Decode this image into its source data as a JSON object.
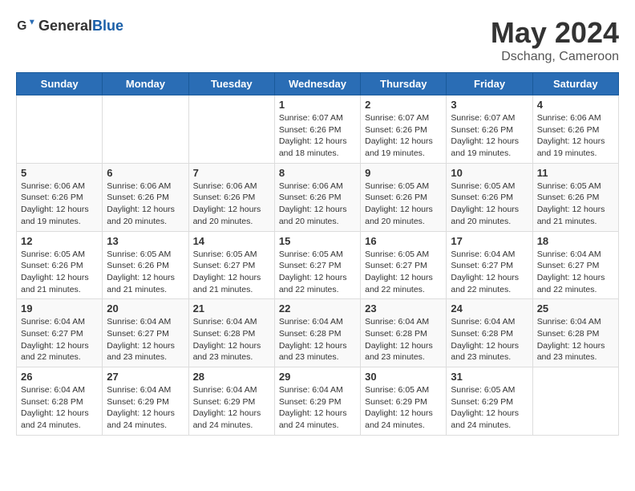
{
  "header": {
    "logo_general": "General",
    "logo_blue": "Blue",
    "month": "May 2024",
    "location": "Dschang, Cameroon"
  },
  "days_of_week": [
    "Sunday",
    "Monday",
    "Tuesday",
    "Wednesday",
    "Thursday",
    "Friday",
    "Saturday"
  ],
  "weeks": [
    [
      {
        "day": "",
        "info": ""
      },
      {
        "day": "",
        "info": ""
      },
      {
        "day": "",
        "info": ""
      },
      {
        "day": "1",
        "info": "Sunrise: 6:07 AM\nSunset: 6:26 PM\nDaylight: 12 hours\nand 18 minutes."
      },
      {
        "day": "2",
        "info": "Sunrise: 6:07 AM\nSunset: 6:26 PM\nDaylight: 12 hours\nand 19 minutes."
      },
      {
        "day": "3",
        "info": "Sunrise: 6:07 AM\nSunset: 6:26 PM\nDaylight: 12 hours\nand 19 minutes."
      },
      {
        "day": "4",
        "info": "Sunrise: 6:06 AM\nSunset: 6:26 PM\nDaylight: 12 hours\nand 19 minutes."
      }
    ],
    [
      {
        "day": "5",
        "info": "Sunrise: 6:06 AM\nSunset: 6:26 PM\nDaylight: 12 hours\nand 19 minutes."
      },
      {
        "day": "6",
        "info": "Sunrise: 6:06 AM\nSunset: 6:26 PM\nDaylight: 12 hours\nand 20 minutes."
      },
      {
        "day": "7",
        "info": "Sunrise: 6:06 AM\nSunset: 6:26 PM\nDaylight: 12 hours\nand 20 minutes."
      },
      {
        "day": "8",
        "info": "Sunrise: 6:06 AM\nSunset: 6:26 PM\nDaylight: 12 hours\nand 20 minutes."
      },
      {
        "day": "9",
        "info": "Sunrise: 6:05 AM\nSunset: 6:26 PM\nDaylight: 12 hours\nand 20 minutes."
      },
      {
        "day": "10",
        "info": "Sunrise: 6:05 AM\nSunset: 6:26 PM\nDaylight: 12 hours\nand 20 minutes."
      },
      {
        "day": "11",
        "info": "Sunrise: 6:05 AM\nSunset: 6:26 PM\nDaylight: 12 hours\nand 21 minutes."
      }
    ],
    [
      {
        "day": "12",
        "info": "Sunrise: 6:05 AM\nSunset: 6:26 PM\nDaylight: 12 hours\nand 21 minutes."
      },
      {
        "day": "13",
        "info": "Sunrise: 6:05 AM\nSunset: 6:26 PM\nDaylight: 12 hours\nand 21 minutes."
      },
      {
        "day": "14",
        "info": "Sunrise: 6:05 AM\nSunset: 6:27 PM\nDaylight: 12 hours\nand 21 minutes."
      },
      {
        "day": "15",
        "info": "Sunrise: 6:05 AM\nSunset: 6:27 PM\nDaylight: 12 hours\nand 22 minutes."
      },
      {
        "day": "16",
        "info": "Sunrise: 6:05 AM\nSunset: 6:27 PM\nDaylight: 12 hours\nand 22 minutes."
      },
      {
        "day": "17",
        "info": "Sunrise: 6:04 AM\nSunset: 6:27 PM\nDaylight: 12 hours\nand 22 minutes."
      },
      {
        "day": "18",
        "info": "Sunrise: 6:04 AM\nSunset: 6:27 PM\nDaylight: 12 hours\nand 22 minutes."
      }
    ],
    [
      {
        "day": "19",
        "info": "Sunrise: 6:04 AM\nSunset: 6:27 PM\nDaylight: 12 hours\nand 22 minutes."
      },
      {
        "day": "20",
        "info": "Sunrise: 6:04 AM\nSunset: 6:27 PM\nDaylight: 12 hours\nand 23 minutes."
      },
      {
        "day": "21",
        "info": "Sunrise: 6:04 AM\nSunset: 6:28 PM\nDaylight: 12 hours\nand 23 minutes."
      },
      {
        "day": "22",
        "info": "Sunrise: 6:04 AM\nSunset: 6:28 PM\nDaylight: 12 hours\nand 23 minutes."
      },
      {
        "day": "23",
        "info": "Sunrise: 6:04 AM\nSunset: 6:28 PM\nDaylight: 12 hours\nand 23 minutes."
      },
      {
        "day": "24",
        "info": "Sunrise: 6:04 AM\nSunset: 6:28 PM\nDaylight: 12 hours\nand 23 minutes."
      },
      {
        "day": "25",
        "info": "Sunrise: 6:04 AM\nSunset: 6:28 PM\nDaylight: 12 hours\nand 23 minutes."
      }
    ],
    [
      {
        "day": "26",
        "info": "Sunrise: 6:04 AM\nSunset: 6:28 PM\nDaylight: 12 hours\nand 24 minutes."
      },
      {
        "day": "27",
        "info": "Sunrise: 6:04 AM\nSunset: 6:29 PM\nDaylight: 12 hours\nand 24 minutes."
      },
      {
        "day": "28",
        "info": "Sunrise: 6:04 AM\nSunset: 6:29 PM\nDaylight: 12 hours\nand 24 minutes."
      },
      {
        "day": "29",
        "info": "Sunrise: 6:04 AM\nSunset: 6:29 PM\nDaylight: 12 hours\nand 24 minutes."
      },
      {
        "day": "30",
        "info": "Sunrise: 6:05 AM\nSunset: 6:29 PM\nDaylight: 12 hours\nand 24 minutes."
      },
      {
        "day": "31",
        "info": "Sunrise: 6:05 AM\nSunset: 6:29 PM\nDaylight: 12 hours\nand 24 minutes."
      },
      {
        "day": "",
        "info": ""
      }
    ]
  ]
}
